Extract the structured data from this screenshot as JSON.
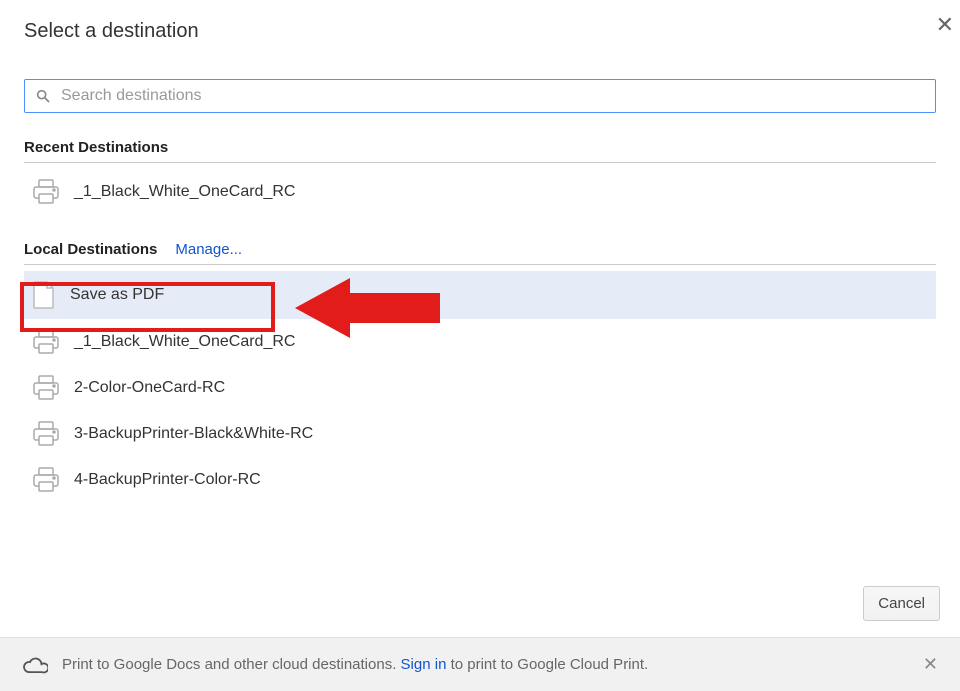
{
  "dialog": {
    "title": "Select a destination"
  },
  "search": {
    "placeholder": "Search destinations"
  },
  "sections": {
    "recent": {
      "title": "Recent Destinations",
      "items": [
        {
          "label": "_1_Black_White_OneCard_RC",
          "icon": "printer"
        }
      ]
    },
    "local": {
      "title": "Local Destinations",
      "manage_label": "Manage...",
      "items": [
        {
          "label": "Save as PDF",
          "icon": "pdf",
          "highlighted": true
        },
        {
          "label": "_1_Black_White_OneCard_RC",
          "icon": "printer"
        },
        {
          "label": "2-Color-OneCard-RC",
          "icon": "printer"
        },
        {
          "label": "3-BackupPrinter-Black&White-RC",
          "icon": "printer"
        },
        {
          "label": "4-BackupPrinter-Color-RC",
          "icon": "printer"
        }
      ]
    }
  },
  "cancel_label": "Cancel",
  "footer": {
    "text_before": "Print to Google Docs and other cloud destinations. ",
    "signin_label": "Sign in",
    "text_after": " to print to Google Cloud Print."
  }
}
